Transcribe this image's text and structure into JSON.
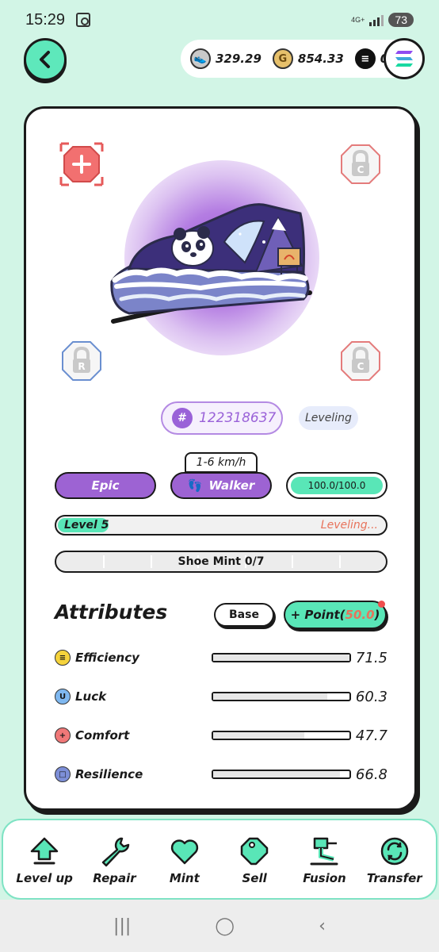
{
  "status": {
    "time": "15:29",
    "network": "4G+",
    "battery": "73"
  },
  "balances": {
    "gst": "329.29",
    "gmt": "854.33",
    "sol": "0"
  },
  "shoe": {
    "id": "122318637",
    "state": "Leveling",
    "speed_range": "1-6 km/h",
    "rarity": "Epic",
    "type": "Walker",
    "durability": "100.0/100.0",
    "durability_ratio": 1.0,
    "level": "Level 5",
    "level_status": "Leveling...",
    "mint": "Shoe Mint 0/7",
    "mint_slots": 7
  },
  "sockets": {
    "top_left": "+",
    "top_right": "C",
    "bottom_left": "R",
    "bottom_right": "C"
  },
  "attributes": {
    "title": "Attributes",
    "base_label": "Base",
    "point_prefix": "+ Point(",
    "point_value": "50.0",
    "point_suffix": ")",
    "items": [
      {
        "name": "Efficiency",
        "value": "71.5",
        "ratio": 1.0,
        "icon": "efficiency-icon",
        "color": "#f5d33c"
      },
      {
        "name": "Luck",
        "value": "60.3",
        "ratio": 0.84,
        "icon": "luck-icon",
        "color": "#7fb8f0"
      },
      {
        "name": "Comfort",
        "value": "47.7",
        "ratio": 0.67,
        "icon": "comfort-icon",
        "color": "#f07878"
      },
      {
        "name": "Resilience",
        "value": "66.8",
        "ratio": 0.93,
        "icon": "resilience-icon",
        "color": "#7d8fd8"
      }
    ]
  },
  "nav": [
    {
      "label": "Level up",
      "icon": "level-up-icon"
    },
    {
      "label": "Repair",
      "icon": "wrench-icon"
    },
    {
      "label": "Mint",
      "icon": "heart-icon"
    },
    {
      "label": "Sell",
      "icon": "tag-icon"
    },
    {
      "label": "Fusion",
      "icon": "hammer-icon"
    },
    {
      "label": "Transfer",
      "icon": "transfer-icon"
    }
  ],
  "colors": {
    "accent": "#59e6b7",
    "purple": "#9d63d3",
    "orange": "#e8735b",
    "background": "#d2f5e6"
  }
}
